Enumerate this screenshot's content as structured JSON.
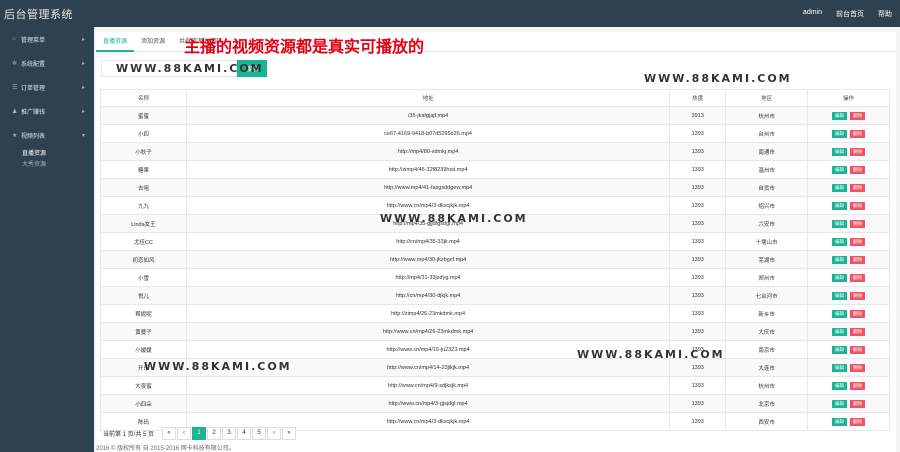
{
  "app": {
    "title": "后台管理系统"
  },
  "topnav": {
    "user": "admin",
    "home": "前台首页",
    "help": "帮助"
  },
  "sidebar": {
    "items": [
      {
        "icon": "home-icon",
        "glyph": "⌂",
        "label": "管理菜单"
      },
      {
        "icon": "settings-icon",
        "glyph": "✲",
        "label": "系统配置"
      },
      {
        "icon": "order-icon",
        "glyph": "☰",
        "label": "订单管理"
      },
      {
        "icon": "user-icon",
        "glyph": "♟",
        "label": "推广赚钱"
      },
      {
        "icon": "star-icon",
        "glyph": "★",
        "label": "视频列表"
      }
    ],
    "subitems": [
      "直播资源",
      "大秀资源"
    ]
  },
  "tabs": [
    "直播资源",
    "添加资源",
    "共有资源 83 部"
  ],
  "search": {
    "placeholder": "",
    "button": "搜索"
  },
  "watermark": "WWW.88KAMI.COM",
  "promo": "主播的视频资源都是真实可播放的",
  "table": {
    "headers": [
      "名称",
      "地址",
      "热度",
      "地区",
      "操作"
    ],
    "edit_label": "编辑",
    "delete_label": "删除",
    "rows": [
      {
        "name": "蜜蜜",
        "url": "/35-jkafgjajf.mp4",
        "heat": "3913",
        "region": "杭州市"
      },
      {
        "name": "小四",
        "url": "ce67-4169-9418-b07d5295d26.mp4",
        "heat": "1393",
        "region": "台州市"
      },
      {
        "name": "小秋子",
        "url": "http://mp4/80-sdmkj.mp4",
        "heat": "1393",
        "region": "南通市"
      },
      {
        "name": "糖果",
        "url": "http://zimp4/46-32f8239hsd.mp4",
        "heat": "1393",
        "region": "温州市"
      },
      {
        "name": "去咀",
        "url": "http://www.mp4/41-fasgsddgew.mp4",
        "heat": "1393",
        "region": "自贡市"
      },
      {
        "name": "九九",
        "url": "http://www.cn/mp4/3-dkscjkjk.mp4",
        "heat": "1393",
        "region": "绍兴市"
      },
      {
        "name": "Linda女王",
        "url": "http://mp4/35-gjjdfgsdgr.mp4",
        "heat": "1393",
        "region": "六安市"
      },
      {
        "name": "尤佳CC",
        "url": "http://cn/mp4/35-33jk.mp4",
        "heat": "1393",
        "region": "十堰山市"
      },
      {
        "name": "初恋如风",
        "url": "http://www.mp4/30-jkzbgcf.mp4",
        "heat": "1393",
        "region": "芜湖市"
      },
      {
        "name": "小雪",
        "url": "http://mp4/31-33jsdyg.mp4",
        "heat": "1393",
        "region": "郑州市"
      },
      {
        "name": "悦儿",
        "url": "http://cn/mp4/30-djkjk.mp4",
        "heat": "1393",
        "region": "七台河市"
      },
      {
        "name": "帮妮呢",
        "url": "http://zimp4/26-23mkdmk.mp4",
        "heat": "1393",
        "region": "新乡市"
      },
      {
        "name": "黄蔓子",
        "url": "http://www.cn/mp4/26-23mkdmk.mp4",
        "heat": "1393",
        "region": "大庆市"
      },
      {
        "name": "小媛媛",
        "url": "http://www.cn/mp4/16-ju2323.mp4",
        "heat": "1393",
        "region": "南京市"
      },
      {
        "name": "开乐",
        "url": "http://www.cn/mp4/14-23jlkjk.mp4",
        "heat": "1393",
        "region": "大连市"
      },
      {
        "name": "大夜蜜",
        "url": "http://www.cn/mp4/9-sdjksjk.mp4",
        "heat": "1393",
        "region": "杭州市"
      },
      {
        "name": "小四朵",
        "url": "http://www.cn/mp4/3-gjsjdgl.mp4",
        "heat": "1393",
        "region": "北京市"
      },
      {
        "name": "陈码",
        "url": "http://www.cn/mp4/3-dkscjkjk.mp4",
        "heat": "1393",
        "region": "西安市"
      }
    ]
  },
  "pager": {
    "info": "当前第 1 页/共 5 页",
    "first": "«",
    "prev": "‹",
    "pages": [
      "1",
      "2",
      "3",
      "4",
      "5"
    ],
    "next": "›",
    "last": "»"
  },
  "footer": "2016 © 版权所有 自 2015-2016 网卡科技有限公司。",
  "colors": {
    "sidebar": "#2f4050",
    "accent": "#1ab394",
    "danger": "#ed5565",
    "promo": "#e60012"
  }
}
